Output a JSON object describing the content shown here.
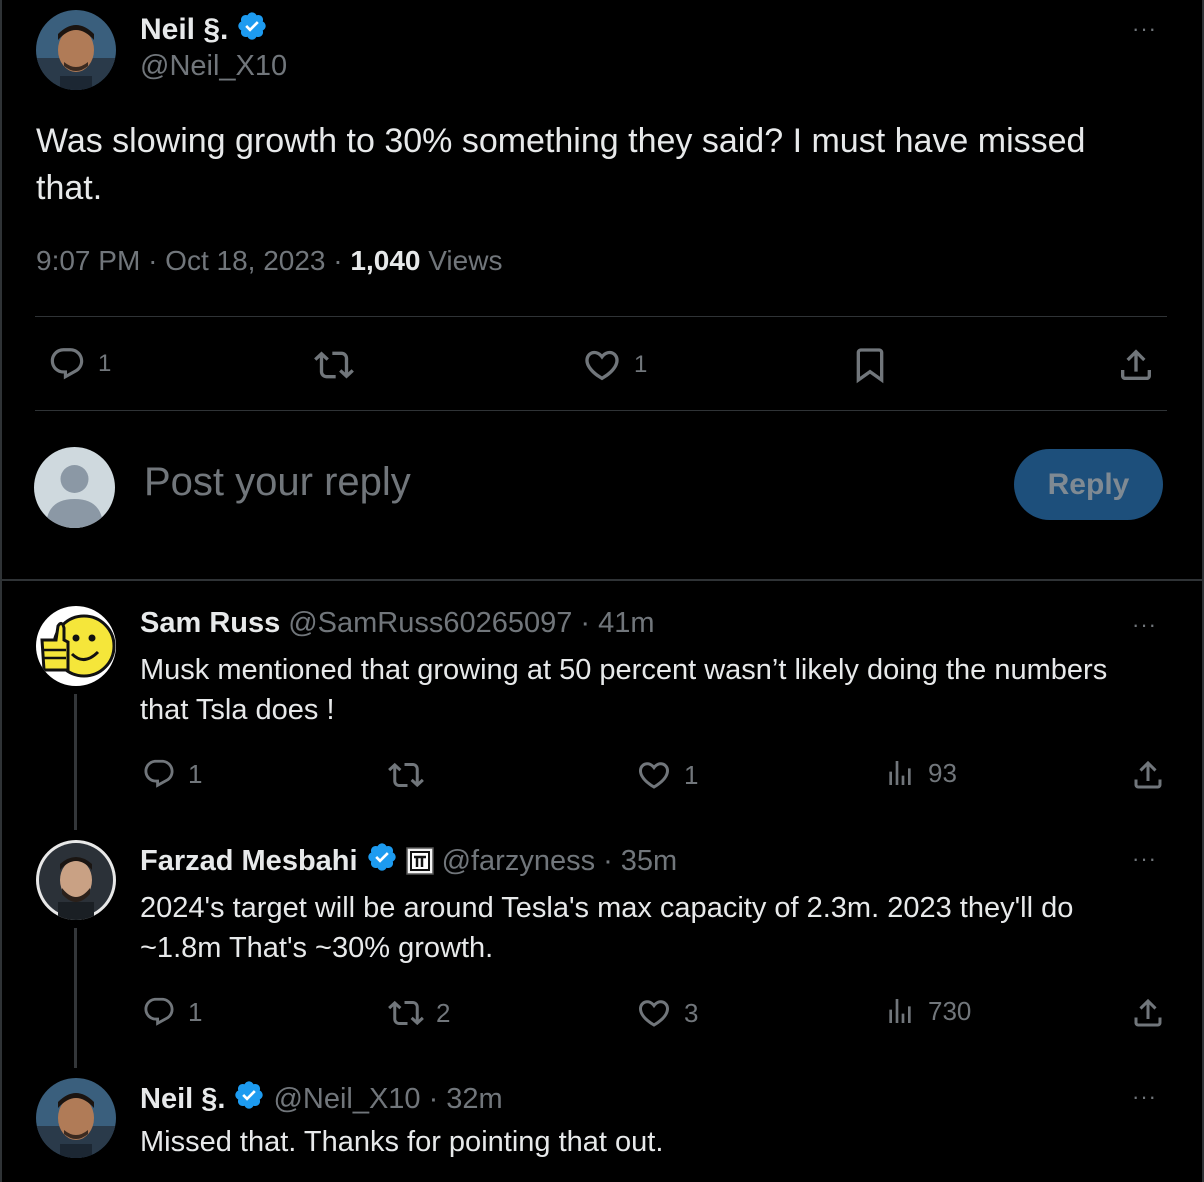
{
  "main_tweet": {
    "name": "Neil §.",
    "handle": "@Neil_X10",
    "text": "Was slowing growth to 30% something they said? I must have missed that.",
    "time": "9:07 PM",
    "date": "Oct 18, 2023",
    "views_count": "1,040",
    "views_label": "Views",
    "sep": "·",
    "reply_count": "1",
    "like_count": "1",
    "more": "···"
  },
  "composer": {
    "placeholder": "Post your reply",
    "button_label": "Reply"
  },
  "replies": [
    {
      "name": "Sam Russ",
      "handle": "@SamRuss60265097",
      "time": "41m",
      "sep": "·",
      "text": "Musk mentioned that growing at 50 percent wasn’t likely doing the numbers that Tsla does !",
      "replies": "1",
      "reposts": "",
      "likes": "1",
      "views": "93",
      "more": "···"
    },
    {
      "name": "Farzad Mesbahi",
      "handle": "@farzyness",
      "time": "35m",
      "sep": "·",
      "text": "2024's target will be around Tesla's max capacity of 2.3m. 2023 they'll do ~1.8m That's ~30% growth.",
      "replies": "1",
      "reposts": "2",
      "likes": "3",
      "views": "730",
      "more": "···"
    },
    {
      "name": "Neil §.",
      "handle": "@Neil_X10",
      "time": "32m",
      "sep": "·",
      "text": "Missed that. Thanks for pointing that out.",
      "more": "···"
    }
  ],
  "colors": {
    "background": "#000000",
    "text": "#e7e9ea",
    "muted": "#71767b",
    "verified": "#1d9bf0",
    "reply_button": "#1d4f7b",
    "divider": "#2f3336"
  },
  "icons": [
    "reply-icon",
    "repost-icon",
    "like-icon",
    "bookmark-icon",
    "share-icon",
    "views-icon",
    "verified-badge-icon",
    "affiliate-badge-icon",
    "more-icon"
  ]
}
